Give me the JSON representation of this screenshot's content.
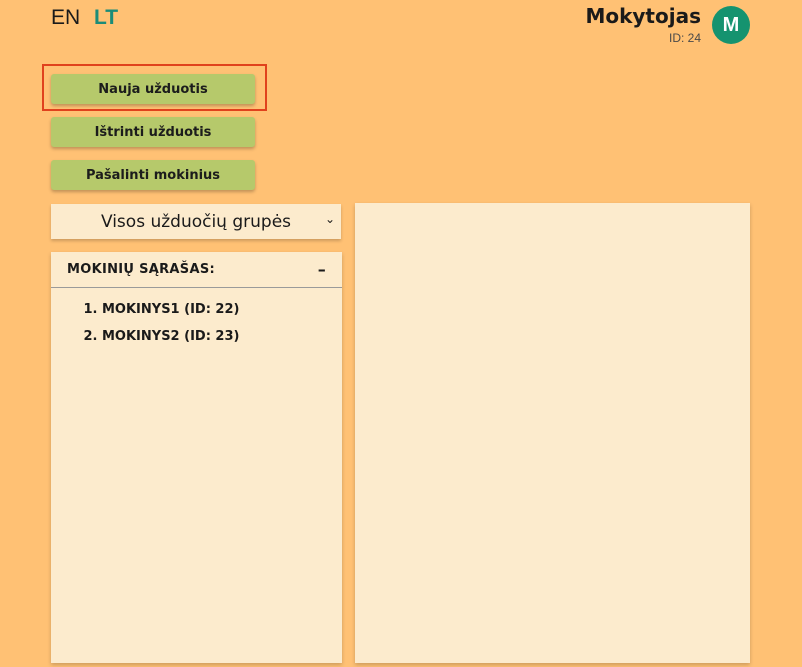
{
  "languages": {
    "en": "EN",
    "lt": "LT"
  },
  "user": {
    "name": "Mokytojas",
    "id": "ID: 24",
    "initial": "M"
  },
  "actions": {
    "new_task": "Nauja užduotis",
    "delete_task": "Ištrinti užduotis",
    "remove_students": "Pašalinti mokinius"
  },
  "group_select": {
    "value": "Visos užduočių grupės"
  },
  "student_list": {
    "title": "MOKINIŲ SĄRAŠAS:",
    "collapse_symbol": "–",
    "items": [
      "MOKINYS1 (ID: 22)",
      "MOKINYS2 (ID: 23)"
    ]
  },
  "colors": {
    "background": "#ffc174",
    "button": "#b6c96b",
    "panel": "#fcebcd",
    "accent": "#15936f",
    "highlight": "#e0421d"
  }
}
